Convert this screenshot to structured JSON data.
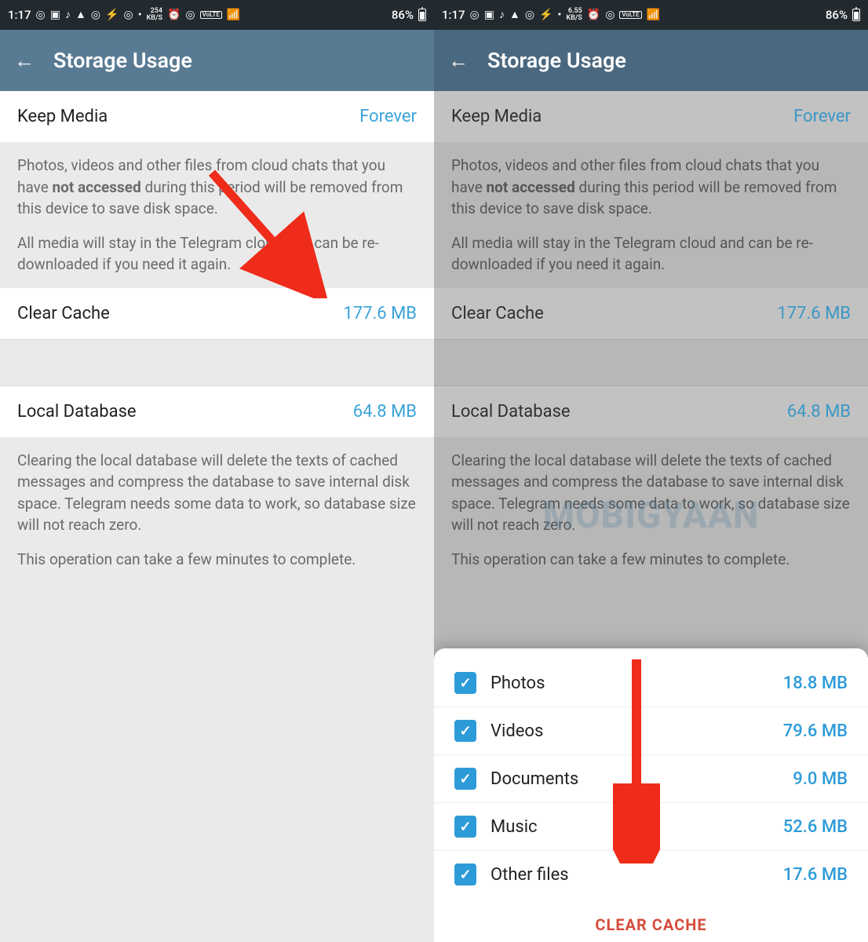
{
  "status_left": {
    "time": "1:17",
    "net_rate_l": "254",
    "net_unit_l": "KB/S",
    "net_rate_r": "6.55",
    "net_unit_r": "KB/S"
  },
  "status_right": {
    "battery": "86%",
    "volte": "VoLTE",
    "signal": "4G"
  },
  "header": {
    "title": "Storage Usage"
  },
  "rows": {
    "keep_media_label": "Keep Media",
    "keep_media_value": "Forever",
    "clear_cache_label": "Clear Cache",
    "clear_cache_value": "177.6 MB",
    "local_db_label": "Local Database",
    "local_db_value": "64.8 MB"
  },
  "info": {
    "keep_media_p1_a": "Photos, videos and other files from cloud chats that you have ",
    "keep_media_p1_b": "not accessed",
    "keep_media_p1_c": " during this period will be removed from this device to save disk space.",
    "keep_media_p2": "All media will stay in the Telegram cloud and can be re-downloaded if you need it again.",
    "local_db_p1": "Clearing the local database will delete the texts of cached messages and compress the database to save internal disk space. Telegram needs some data to work, so database size will not reach zero.",
    "local_db_p2": "This operation can take a few minutes to complete."
  },
  "dialog": {
    "items": [
      {
        "label": "Photos",
        "value": "18.8 MB"
      },
      {
        "label": "Videos",
        "value": "79.6 MB"
      },
      {
        "label": "Documents",
        "value": "9.0 MB"
      },
      {
        "label": "Music",
        "value": "52.6 MB"
      },
      {
        "label": "Other files",
        "value": "17.6 MB"
      }
    ],
    "button": "CLEAR CACHE"
  },
  "watermark": "MOBIGYAAN"
}
